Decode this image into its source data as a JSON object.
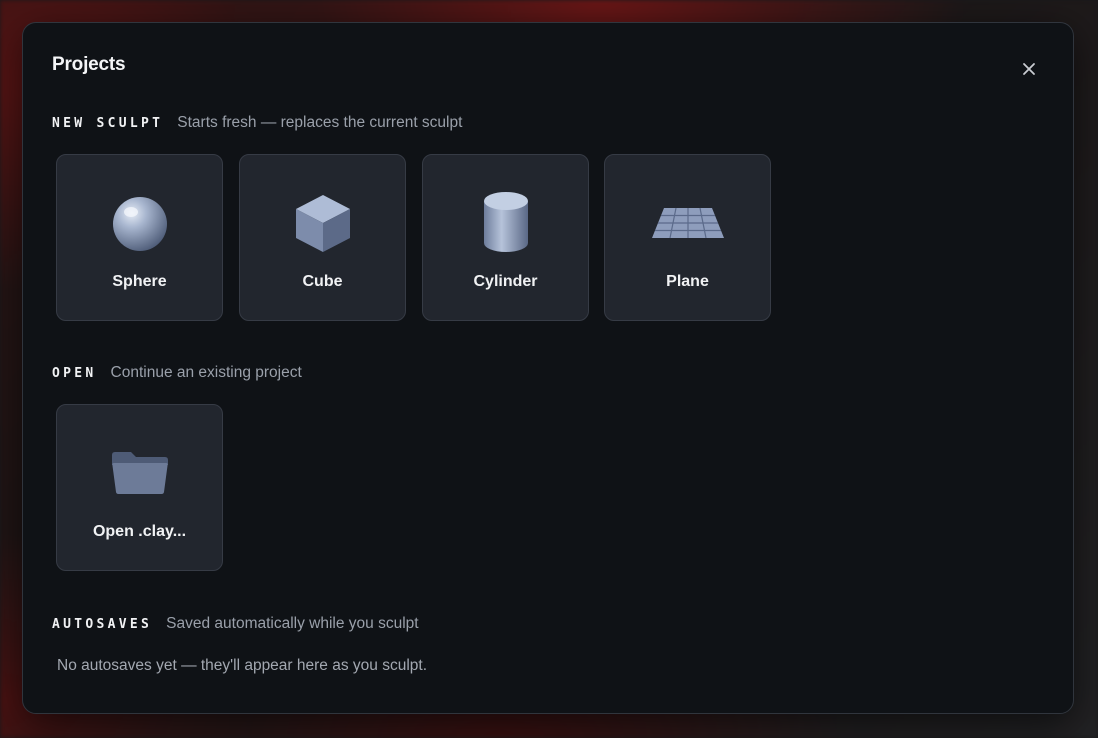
{
  "dialog": {
    "title": "Projects",
    "close_icon": "close-icon"
  },
  "new_sculpt": {
    "label": "NEW SCULPT",
    "description": "Starts fresh — replaces the current sculpt",
    "items": [
      {
        "label": "Sphere",
        "icon": "sphere-icon"
      },
      {
        "label": "Cube",
        "icon": "cube-icon"
      },
      {
        "label": "Cylinder",
        "icon": "cylinder-icon"
      },
      {
        "label": "Plane",
        "icon": "plane-icon"
      }
    ]
  },
  "open": {
    "label": "OPEN",
    "description": "Continue an existing project",
    "items": [
      {
        "label": "Open .clay...",
        "icon": "folder-icon"
      }
    ]
  },
  "autosaves": {
    "label": "AUTOSAVES",
    "description": "Saved automatically while you sculpt",
    "empty_message": "No autosaves yet — they'll appear here as you sculpt."
  }
}
